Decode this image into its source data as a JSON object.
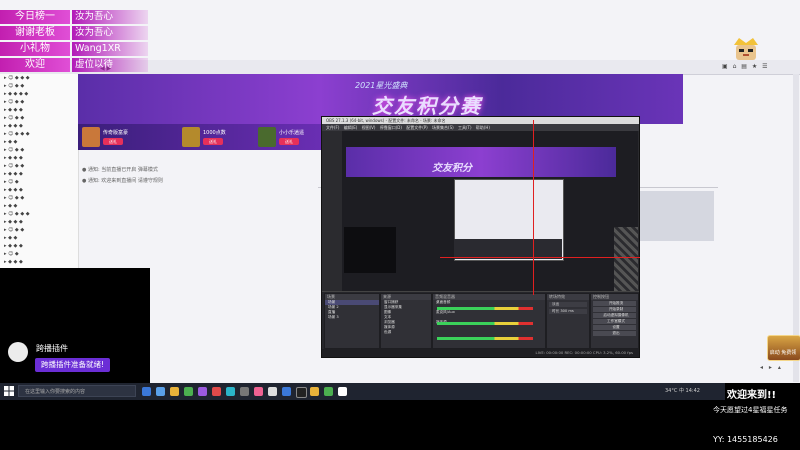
{
  "overlay": {
    "rows": [
      {
        "label": "今日榜一",
        "value": "汝为吾心"
      },
      {
        "label": "谢谢老板",
        "value": "汝为吾心"
      },
      {
        "label": "小礼物",
        "value": "Wang1XR"
      },
      {
        "label": "欢迎",
        "value": "虚位以待"
      }
    ]
  },
  "banner": {
    "title": "交友积分赛",
    "subtitle": "2021星光盛典"
  },
  "gifts": [
    {
      "label": "传奇版富豪",
      "button": "送礼"
    },
    {
      "label": "1000点数",
      "button": "送礼"
    },
    {
      "label": "小小乐逍遥",
      "button": "送礼"
    }
  ],
  "chat": {
    "line1": "● 通知: 当前直播已开启 弹幕模式",
    "line2": "● 通知: 欢迎来到直播间 请遵守规则"
  },
  "obs": {
    "title": "OBS 27.1.3 (64-bit, windows) - 配置文件: 未命名 - 场景: 未命名",
    "menu": "文件(F) 编辑(E) 视图(V) 停靠窗口(D) 配置文件(P) 场景集合(S) 工具(T) 帮助(H)",
    "inner_title": "交友积分",
    "docks": {
      "scenes": {
        "header": "场景",
        "items": [
          "场景",
          "场景 2",
          "直播",
          "场景 3"
        ]
      },
      "sources": {
        "header": "来源",
        "items": [
          "窗口捕获",
          "显示器采集",
          "图像",
          "文本",
          "浏览器",
          "媒体源",
          "色源"
        ]
      },
      "mixer": {
        "header": "音频混音器",
        "items": [
          "桌面音频",
          "麦克风/Aux",
          "媒体源"
        ]
      },
      "transitions": {
        "header": "转场特效",
        "items": [
          "淡出",
          "时长 300 ms"
        ]
      },
      "controls": {
        "header": "控制按钮",
        "items": [
          "开始推流",
          "开始录制",
          "启动虚拟摄像机",
          "工作室模式",
          "设置",
          "退出"
        ]
      }
    },
    "status": "LIVE: 00:00:00   REC: 00:00:00   CPU: 3.2%, 60.00 fps"
  },
  "plugin": {
    "name": "跨播插件",
    "message": "跨播插件准备就绪!"
  },
  "taskbar": {
    "search_placeholder": "在这里输入你要搜索的内容",
    "tray": "34°C  中  14:42"
  },
  "bottom_right": {
    "welcome": "欢迎来到!!",
    "task": "今天愿望过4星福星任务",
    "yy": "YY:  1455185426"
  },
  "badge_bottom_label": "启动 免费领",
  "colors": {
    "overlay_pink": "#c21fb0",
    "banner_purple": "#6d2fb7",
    "plugin_purple": "#6b2ed6",
    "taskbar": "#1f2430"
  }
}
